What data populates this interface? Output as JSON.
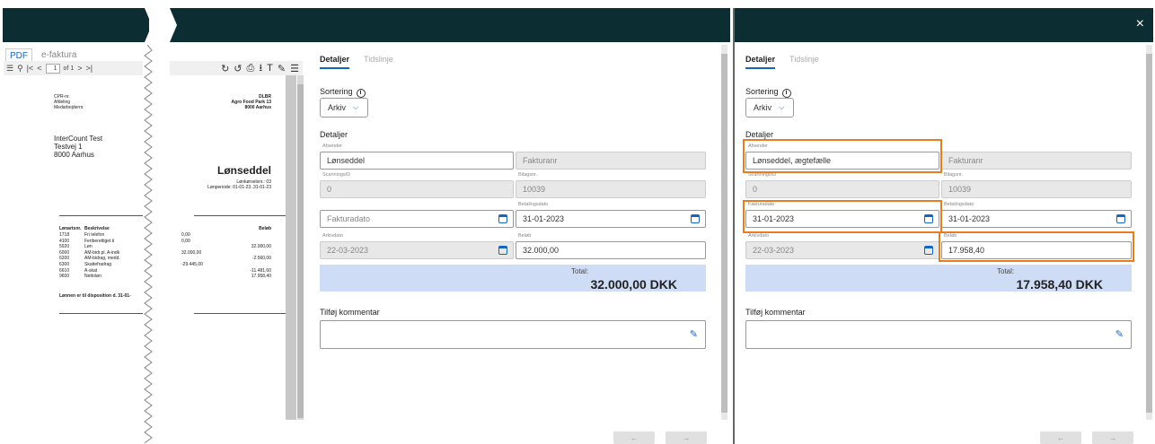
{
  "close_label": "×",
  "pdf": {
    "tabs": [
      {
        "label": "PDF"
      },
      {
        "label": "e-faktura"
      }
    ],
    "toolbar": {
      "first": "|<",
      "prev": "<",
      "page": "1",
      "of": "of 1",
      "next": ">",
      "last": ">|"
    },
    "doc": {
      "cpr": "CPR-nr.",
      "afdeling": "Afdeling",
      "medarbejdernr": "Medarbejdernr.",
      "company": "DLBR",
      "address1": "Agro Food Park 13",
      "address2": "8000 Aarhus",
      "recipient": [
        "InterCount Test",
        "Testvej 1",
        "8000 Aarhus"
      ],
      "title": "Lønseddel",
      "sub1": "Lønkørselsnr.: 03",
      "sub2": "Lønperiode: 01-01-23..31-01-23",
      "col_nr": "Lønartsnr.",
      "col_desc": "Beskrivelse",
      "col_amount": "Beløb",
      "rows": [
        {
          "nr": "1718",
          "desc": "Fri telefon",
          "a": "0,00",
          "b": ""
        },
        {
          "nr": "4100",
          "desc": "Feriberettiget ti",
          "a": "0,00",
          "b": ""
        },
        {
          "nr": "5920",
          "desc": "Løn",
          "a": "",
          "b": "32.000,00"
        },
        {
          "nr": "6000",
          "desc": "AM-bidr.pl. A-indk",
          "a": "32.000,00",
          "b": ""
        },
        {
          "nr": "6200",
          "desc": "AM-bidrag, medd.",
          "a": "",
          "b": "-2.560,00"
        },
        {
          "nr": "6300",
          "desc": "Skattefradrag",
          "a": "-29.445,00",
          "b": ""
        },
        {
          "nr": "6610",
          "desc": "A-skat",
          "a": "",
          "b": "-11.481,60"
        },
        {
          "nr": "9600",
          "desc": "Nettoløn",
          "a": "",
          "b": "17.958,40"
        }
      ],
      "footer": "Lønnen er til disposition d. 31-01-"
    }
  },
  "left_form": {
    "tabs": [
      {
        "label": "Detaljer"
      },
      {
        "label": "Tidslinje"
      }
    ],
    "sortering": "Sortering",
    "arkiv": "Arkiv",
    "detaljer": "Detaljer",
    "afsender_label": "Afsender",
    "afsender": "Lønseddel",
    "fakturanr": "Fakturanr",
    "scanning_label": "ScanningsID",
    "scanning": "0",
    "bilagsnr_label": "Bilagsnr.",
    "bilagsnr": "10039",
    "fakturadato": "Fakturadato",
    "betalingsdato_label": "Betalingsdato",
    "betalingsdato": "31-01-2023",
    "arkivdato_label": "Arkivdato",
    "arkivdato": "22-03-2023",
    "beloeb_label": "Beløb",
    "beloeb": "32.000,00",
    "total_label": "Total:",
    "total_value": "32.000,00 DKK",
    "kommentar": "Tilføj kommentar"
  },
  "right_form": {
    "tabs": [
      {
        "label": "Detaljer"
      },
      {
        "label": "Tidslinje"
      }
    ],
    "sortering": "Sortering",
    "arkiv": "Arkiv",
    "detaljer": "Detaljer",
    "afsender_label": "Afsender",
    "afsender": "Lønseddel, ægtefælle",
    "fakturanr": "Fakturanr",
    "scanning_label": "ScanningsID",
    "scanning": "0",
    "bilagsnr_label": "Bilagsnr.",
    "bilagsnr": "10039",
    "fakturadato_label": "Fakturadato",
    "fakturadato": "31-01-2023",
    "betalingsdato_label": "Betalingsdato",
    "betalingsdato": "31-01-2023",
    "arkivdato_label": "Arkivdato",
    "arkivdato": "22-03-2023",
    "beloeb_label": "Beløb",
    "beloeb": "17.958,40",
    "total_label": "Total:",
    "total_value": "17.958,40 DKK",
    "kommentar": "Tilføj kommentar"
  },
  "nav": {
    "prev": "←",
    "next": "→"
  },
  "colors": {
    "header": "#0c2e33",
    "accent": "#1565c0",
    "highlight": "#e87c1e",
    "total_bg": "#cfdcf5"
  }
}
